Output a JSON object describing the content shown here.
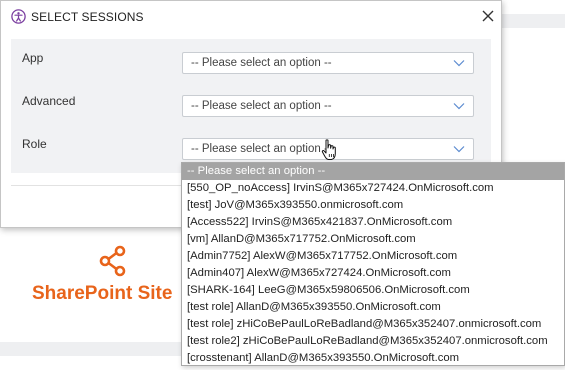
{
  "page": {
    "site_name": "SharePoint Site"
  },
  "dialog": {
    "title": "SELECT SESSIONS",
    "icons": {
      "header": "accessibility-icon",
      "close": "close-icon"
    },
    "fields": [
      {
        "label": "App",
        "value": "-- Please select an option --"
      },
      {
        "label": "Advanced",
        "value": "-- Please select an option --"
      },
      {
        "label": "Role",
        "value": "-- Please select an option --"
      }
    ]
  },
  "dropdown": {
    "selected_index": 0,
    "options": [
      "-- Please select an option --",
      "[550_OP_noAccess] IrvinS@M365x727424.OnMicrosoft.com",
      "[test] JoV@M365x393550.onmicrosoft.com",
      "[Access522] IrvinS@M365x421837.OnMicrosoft.com",
      "[vm] AllanD@M365x717752.OnMicrosoft.com",
      "[Admin7752] AlexW@M365x717752.OnMicrosoft.com",
      "[Admin407] AlexW@M365x727424.OnMicrosoft.com",
      "[SHARK-164] LeeG@M365x59806506.OnMicrosoft.com",
      "[test role] AllanD@M365x393550.OnMicrosoft.com",
      "[test role] zHiCoBePaulLoReBadland@M365x352407.onmicrosoft.com",
      "[test role2] zHiCoBePaulLoReBadland@M365x352407.onmicrosoft.com",
      "[crosstenant] AllanD@M365x393550.OnMicrosoft.com"
    ]
  },
  "colors": {
    "brand_orange": "#e8641b",
    "header_icon_purple": "#7b3fa0",
    "selected_option_bg": "#a4a4a4",
    "body_panel_bg": "#f1f2f4",
    "chevron_blue": "#5b8bd0"
  }
}
